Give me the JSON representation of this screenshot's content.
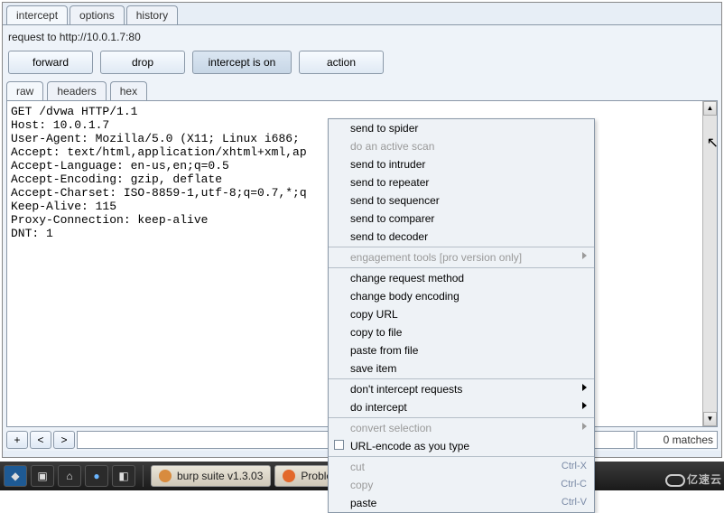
{
  "tabs": {
    "intercept": "intercept",
    "options": "options",
    "history": "history"
  },
  "request_line": "request to http://10.0.1.7:80",
  "buttons": {
    "forward": "forward",
    "drop": "drop",
    "intercept": "intercept is on",
    "action": "action"
  },
  "subtabs": {
    "raw": "raw",
    "headers": "headers",
    "hex": "hex"
  },
  "raw_request": "GET /dvwa HTTP/1.1\nHost: 10.0.1.7\nUser-Agent: Mozilla/5.0 (X11; Linux i686; \nAccept: text/html,application/xhtml+xml,ap\nAccept-Language: en-us,en;q=0.5\nAccept-Encoding: gzip, deflate\nAccept-Charset: ISO-8859-1,utf-8;q=0.7,*;q\nKeep-Alive: 115\nProxy-Connection: keep-alive\nDNT: 1\n",
  "search": {
    "plus": "+",
    "prev": "<",
    "next": ">",
    "matches": "0 matches"
  },
  "ctx": {
    "spider": "send to spider",
    "activescan": "do an active scan",
    "intruder": "send to intruder",
    "repeater": "send to repeater",
    "sequencer": "send to sequencer",
    "comparer": "send to comparer",
    "decoder": "send to decoder",
    "engagement": "engagement tools [pro version only]",
    "changemethod": "change request method",
    "changeenc": "change body encoding",
    "copyurl": "copy URL",
    "copyfile": "copy to file",
    "pastefile": "paste from file",
    "saveitem": "save item",
    "dontintercept": "don't intercept requests",
    "dointercept": "do intercept",
    "convert": "convert selection",
    "urlencode": "URL-encode as you type",
    "cut": "cut",
    "copy": "copy",
    "paste": "paste",
    "sc_cut": "Ctrl-X",
    "sc_copy": "Ctrl-C",
    "sc_paste": "Ctrl-V"
  },
  "taskbar": {
    "burp": "burp suite v1.3.03",
    "problem": "Problem lo"
  },
  "watermark": "亿速云"
}
